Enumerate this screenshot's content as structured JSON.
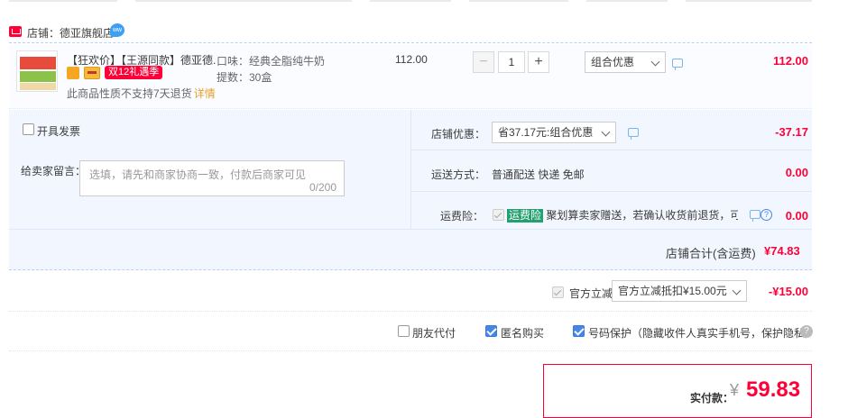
{
  "shop": {
    "badge_icon": "tmall-icon",
    "name": "店铺：德亚旗舰店",
    "wangwang_icon": "wangwang-icon"
  },
  "item": {
    "title": "【狂欢价】【王源同款】德亚德...",
    "badge_red": "双12礼遇季",
    "note": "此商品性质不支持7天退货",
    "detail_link": "详情",
    "sku_flavor": "口味：经典全脂纯牛奶",
    "sku_pack": "提数：30盒",
    "price": "112.00",
    "quantity": "1",
    "promo_select": "组合优惠",
    "subtotal": "112.00"
  },
  "invoice": {
    "label": "开具发票",
    "checked": false
  },
  "message": {
    "label": "给卖家留言：",
    "placeholder": "选填，请先和商家协商一致，付款后商家可见",
    "counter": "0/200"
  },
  "shop_discount": {
    "label": "店铺优惠：",
    "select": "省37.17元:组合优惠",
    "amount": "-37.17"
  },
  "shipping": {
    "label": "运送方式：",
    "value": "普通配送 快递 免邮",
    "amount": "0.00"
  },
  "insurance": {
    "label": "运费险：",
    "tag": "运费险",
    "text": "聚划算卖家赠送，若确认收货前退货，可获...",
    "help": "?",
    "amount": "0.00"
  },
  "shop_total": {
    "label": "店铺合计(含运费)",
    "amount": "¥74.83"
  },
  "official": {
    "label": "官方立减",
    "select": "官方立减抵扣¥15.00元",
    "amount": "-¥15.00"
  },
  "options": {
    "friend_pay": "朋友代付",
    "anonymous": "匿名购买",
    "number_protect": "号码保护（隐藏收件人真实手机号，保护隐私）",
    "help": "?"
  },
  "payment": {
    "label": "实付款：",
    "currency": "¥",
    "amount": "59.83"
  },
  "colors": {
    "accent_red": "#ff0036",
    "accent_blue": "#4586e6",
    "block_bg": "#f2f7ff"
  }
}
